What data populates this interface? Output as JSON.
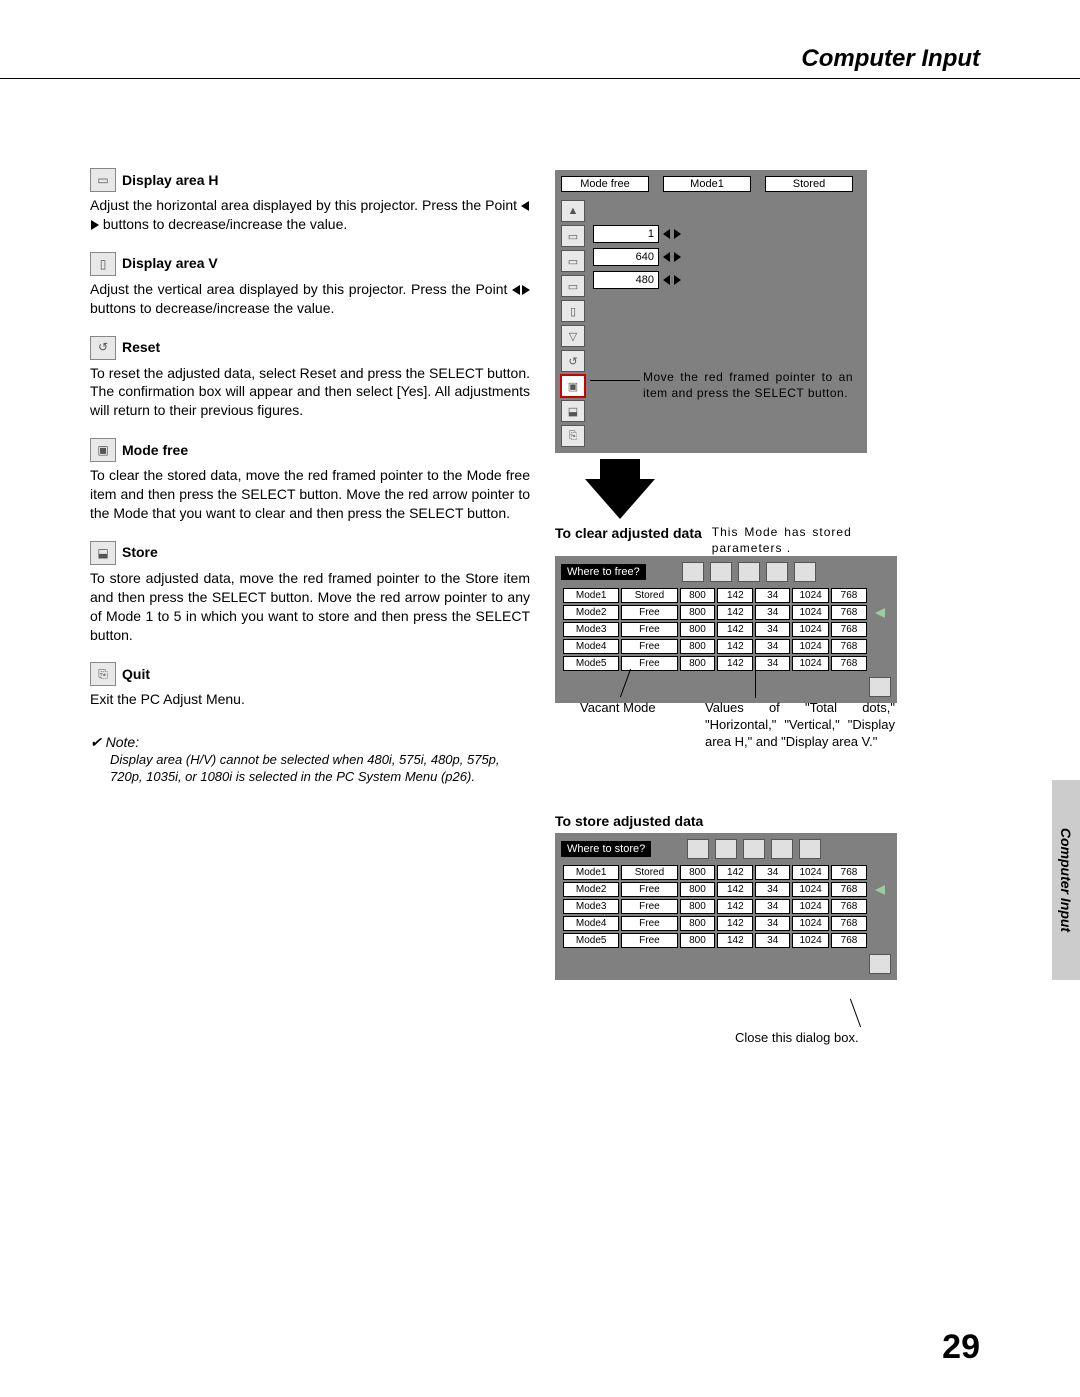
{
  "header": {
    "section_title": "Computer Input"
  },
  "left": {
    "items": [
      {
        "title": "Display area H",
        "body_pre": "Adjust the horizontal area displayed by this projector.  Press the Point ",
        "body_post": " buttons to decrease/increase the value."
      },
      {
        "title": "Display area V",
        "body_pre": "Adjust the vertical area displayed by this projector.  Press the Point ",
        "body_post": " buttons to decrease/increase the value."
      },
      {
        "title": "Reset",
        "body": "To reset the adjusted data, select Reset and press the SELECT button.  The confirmation box will appear and then select [Yes].  All adjustments will return to their previous figures."
      },
      {
        "title": "Mode free",
        "body": "To clear the stored data, move the red framed pointer to the Mode free item and then press the SELECT button.  Move the red arrow pointer to the Mode that you want to clear and then press the SELECT button."
      },
      {
        "title": "Store",
        "body": "To store adjusted data, move the red framed pointer to the Store item and then press the SELECT button.  Move the red arrow pointer to any of Mode 1 to 5 in which you want to store and then press the SELECT button."
      },
      {
        "title": "Quit",
        "body": "Exit the PC Adjust Menu."
      }
    ],
    "note_head": "✔ Note:",
    "note_body": "Display area (H/V) cannot be selected when 480i, 575i, 480p, 575p, 720p, 1035i, or 1080i is selected in the PC System Menu (p26)."
  },
  "right": {
    "panel": {
      "tabs": [
        "Mode free",
        "Mode1",
        "Stored"
      ],
      "values": [
        "1",
        "640",
        "480"
      ],
      "callout": "Move the red framed pointer to an item and press the SELECT button."
    },
    "clear": {
      "caption": "To clear adjusted data",
      "side_note": "This Mode has stored parameters .",
      "dlg_title": "Where to free?",
      "rows": [
        {
          "mode": "Mode1",
          "status": "Stored",
          "v": [
            "800",
            "142",
            "34",
            "1024",
            "768"
          ]
        },
        {
          "mode": "Mode2",
          "status": "Free",
          "v": [
            "800",
            "142",
            "34",
            "1024",
            "768"
          ]
        },
        {
          "mode": "Mode3",
          "status": "Free",
          "v": [
            "800",
            "142",
            "34",
            "1024",
            "768"
          ]
        },
        {
          "mode": "Mode4",
          "status": "Free",
          "v": [
            "800",
            "142",
            "34",
            "1024",
            "768"
          ]
        },
        {
          "mode": "Mode5",
          "status": "Free",
          "v": [
            "800",
            "142",
            "34",
            "1024",
            "768"
          ]
        }
      ],
      "anno_vacant": "Vacant Mode",
      "anno_values": "Values of \"Total dots,\" \"Horizontal,\" \"Vertical,\" \"Display area H,\" and \"Display area V.\""
    },
    "store": {
      "caption": "To store adjusted data",
      "dlg_title": "Where to store?",
      "rows": [
        {
          "mode": "Mode1",
          "status": "Stored",
          "v": [
            "800",
            "142",
            "34",
            "1024",
            "768"
          ]
        },
        {
          "mode": "Mode2",
          "status": "Free",
          "v": [
            "800",
            "142",
            "34",
            "1024",
            "768"
          ]
        },
        {
          "mode": "Mode3",
          "status": "Free",
          "v": [
            "800",
            "142",
            "34",
            "1024",
            "768"
          ]
        },
        {
          "mode": "Mode4",
          "status": "Free",
          "v": [
            "800",
            "142",
            "34",
            "1024",
            "768"
          ]
        },
        {
          "mode": "Mode5",
          "status": "Free",
          "v": [
            "800",
            "142",
            "34",
            "1024",
            "768"
          ]
        }
      ],
      "anno_close": "Close this dialog box."
    }
  },
  "side_tab_text": "Computer Input",
  "page_number": "29"
}
